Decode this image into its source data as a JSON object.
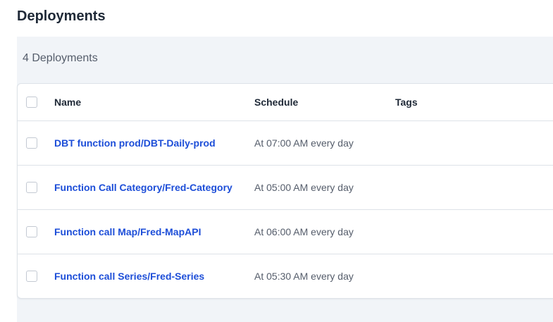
{
  "page": {
    "title": "Deployments",
    "count_label": "4 Deployments"
  },
  "table": {
    "headers": {
      "name": "Name",
      "schedule": "Schedule",
      "tags": "Tags"
    },
    "rows": [
      {
        "flow": "DBT function prod",
        "separator": "/",
        "deployment": "DBT-Daily-prod",
        "schedule": "At 07:00 AM every day"
      },
      {
        "flow": "Function Call Category",
        "separator": "/",
        "deployment": "Fred-Category",
        "schedule": "At 05:00 AM every day"
      },
      {
        "flow": "Function call Map",
        "separator": "/",
        "deployment": "Fred-MapAPI",
        "schedule": "At 06:00 AM every day"
      },
      {
        "flow": "Function call Series",
        "separator": "/",
        "deployment": "Fred-Series",
        "schedule": "At 05:30 AM every day"
      }
    ]
  },
  "colors": {
    "link": "#1d4ed8",
    "panel_background": "#f1f4f8",
    "border": "#dde2e8"
  }
}
